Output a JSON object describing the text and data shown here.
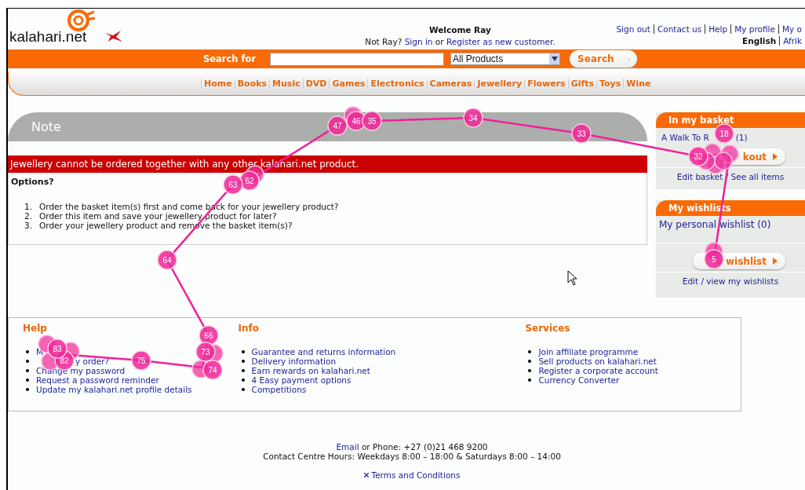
{
  "header": {
    "logo": "kalahari.net",
    "welcome": "Welcome Ray",
    "not_user": "Not Ray?",
    "sign_in": "Sign in",
    "or": "or",
    "register": "Register as new customer.",
    "top_links": [
      "Sign out",
      "Contact us",
      "Help",
      "My profile",
      "My o"
    ],
    "languages": [
      {
        "label": "English",
        "selected": true
      },
      {
        "label": "Afrik",
        "selected": false
      }
    ]
  },
  "search": {
    "label": "Search for",
    "category": "All Products",
    "button": "Search"
  },
  "nav": [
    "Home",
    "Books",
    "Music",
    "DVD",
    "Games",
    "Electronics",
    "Cameras",
    "Jewellery",
    "Flowers",
    "Gifts",
    "Toys",
    "Wine"
  ],
  "note": {
    "title": "Note",
    "alert": "Jewellery cannot be ordered together with any other kalahari.net product.",
    "options_heading": "Options?",
    "options": [
      {
        "number": "1.",
        "text": "Order the basket item(s) first and come back for your jewellery product?"
      },
      {
        "number": "2.",
        "text": "Order this item and save your jewellery product for later?"
      },
      {
        "number": "3.",
        "text": "Order your jewellery product and remove the basket item(s)?"
      }
    ]
  },
  "basket": {
    "title": "In my basket",
    "item": "A Walk To R",
    "count": "(1)",
    "button": "kout",
    "links": "Edit basket / See all items"
  },
  "wishlists": {
    "title": "My wishlists",
    "item": "My personal wishlist (0)",
    "button": "e wishlist",
    "links": "Edit / view my wishlists"
  },
  "footer_columns": [
    {
      "title": "Help",
      "links": [
        "M",
        "y order?",
        "Change my password",
        "Request a password reminder",
        "Update my kalahari.net profile details"
      ]
    },
    {
      "title": "Info",
      "links": [
        "Guarantee and returns information",
        "Delivery information",
        "Earn rewards on kalahari.net",
        "4 Easy payment options",
        "Competitions"
      ]
    },
    {
      "title": "Services",
      "links": [
        "Join affiliate programme",
        "Sell products on kalahari.net",
        "Register a corporate account",
        "Currency Converter"
      ]
    }
  ],
  "contact": {
    "email": "Email",
    "phone": "or Phone: +27 (0)21 468 9200",
    "hours": "Contact Centre Hours: Weekdays 8:00 – 18:00 & Saturdays 8:00 – 14:00",
    "terms": "Terms and Conditions"
  },
  "fixations": [
    {
      "label": "5"
    },
    {
      "label": "18"
    },
    {
      "label": "32"
    },
    {
      "label": "33"
    },
    {
      "label": "34"
    },
    {
      "label": "47"
    },
    {
      "label": "46"
    },
    {
      "label": "35"
    },
    {
      "label": "62"
    },
    {
      "label": "63"
    },
    {
      "label": "64"
    },
    {
      "label": "66"
    },
    {
      "label": "73"
    },
    {
      "label": "74"
    },
    {
      "label": "75"
    },
    {
      "label": "82"
    },
    {
      "label": "83"
    }
  ]
}
